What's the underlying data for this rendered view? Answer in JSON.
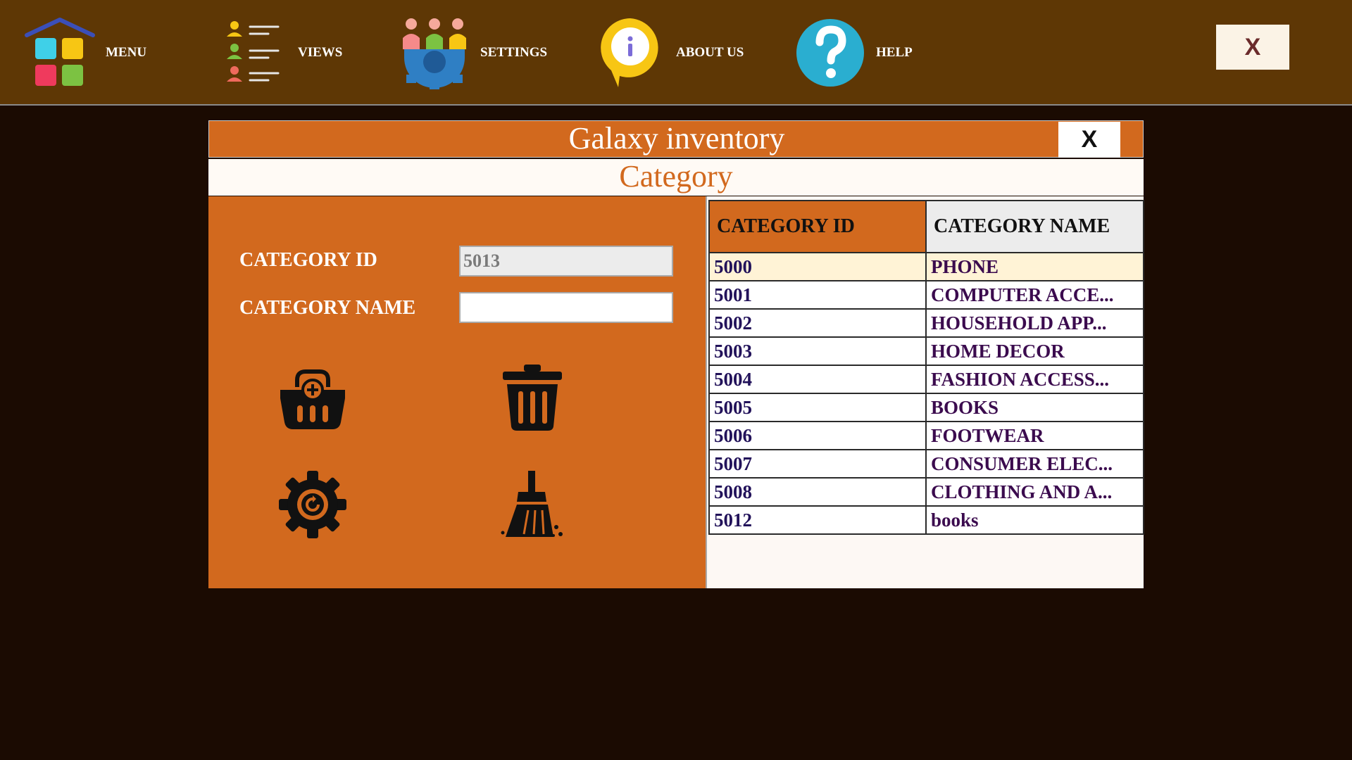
{
  "nav": {
    "menu_label": "MENU",
    "views_label": "VIEWS",
    "settings_label": "SETTINGS",
    "about_label": "ABOUT US",
    "help_label": "HELP",
    "close_label": "X"
  },
  "dialog": {
    "title": "Galaxy inventory",
    "close_label": "X",
    "subtitle": "Category"
  },
  "form": {
    "category_id_label": "CATEGORY ID",
    "category_id_value": "5013",
    "category_name_label": "CATEGORY NAME",
    "category_name_value": ""
  },
  "table": {
    "headers": [
      "CATEGORY ID",
      "CATEGORY NAME"
    ],
    "rows": [
      {
        "id": "5000",
        "name": "PHONE"
      },
      {
        "id": "5001",
        "name": "COMPUTER ACCE..."
      },
      {
        "id": "5002",
        "name": "HOUSEHOLD APP..."
      },
      {
        "id": "5003",
        "name": "HOME DECOR"
      },
      {
        "id": "5004",
        "name": "FASHION ACCESS..."
      },
      {
        "id": "5005",
        "name": "BOOKS"
      },
      {
        "id": "5006",
        "name": "FOOTWEAR"
      },
      {
        "id": "5007",
        "name": "CONSUMER ELEC..."
      },
      {
        "id": "5008",
        "name": "CLOTHING AND A..."
      },
      {
        "id": "5012",
        "name": "books"
      }
    ],
    "selected_row": 0
  },
  "icons": {
    "menu": "menu-grid-icon",
    "views": "views-list-icon",
    "settings": "settings-people-gear-icon",
    "about": "info-icon",
    "help": "help-question-icon",
    "add": "add-basket-icon",
    "delete": "trash-icon",
    "update": "gear-icon",
    "clear": "broom-icon"
  },
  "colors": {
    "topbar": "#5e3705",
    "background": "#1b0b02",
    "accent": "#d2691e",
    "selected_row": "#fff3d6"
  }
}
